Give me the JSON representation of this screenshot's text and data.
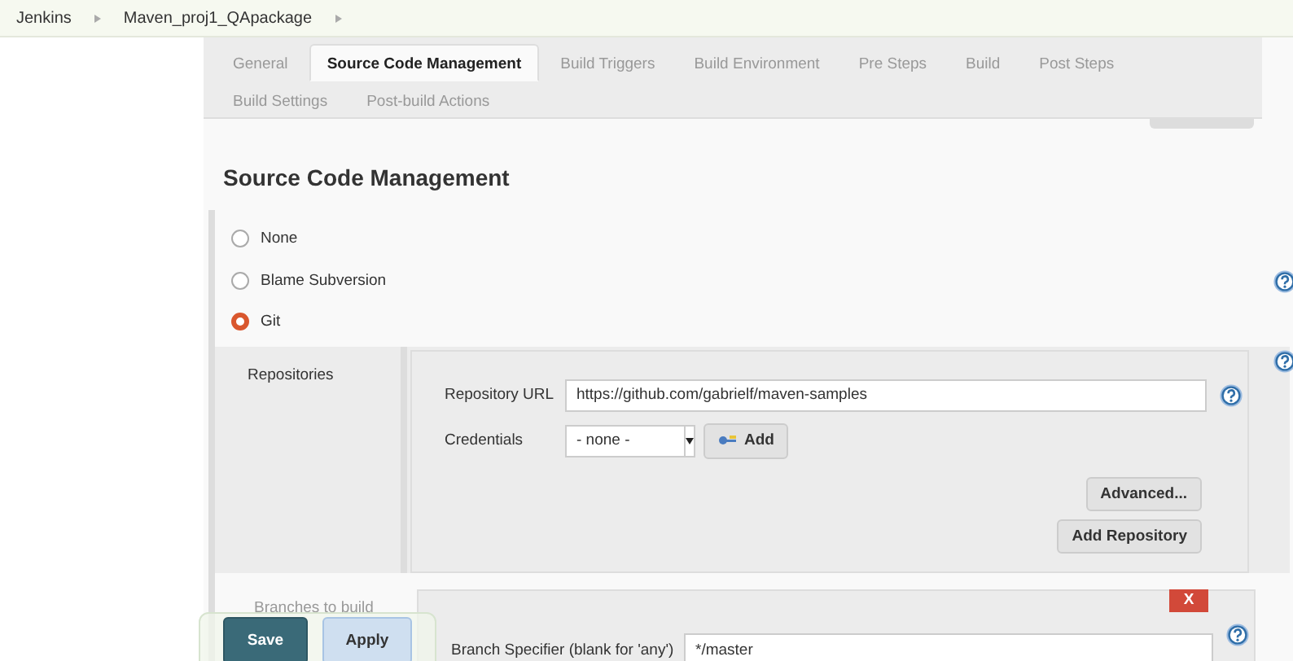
{
  "breadcrumbs": [
    {
      "label": "Jenkins"
    },
    {
      "label": "Maven_proj1_QApackage"
    }
  ],
  "tabs": [
    {
      "label": "General",
      "selected": false
    },
    {
      "label": "Source Code Management",
      "selected": true
    },
    {
      "label": "Build Triggers",
      "selected": false
    },
    {
      "label": "Build Environment",
      "selected": false
    },
    {
      "label": "Pre Steps",
      "selected": false
    },
    {
      "label": "Build",
      "selected": false
    },
    {
      "label": "Post Steps",
      "selected": false
    },
    {
      "label": "Build Settings",
      "selected": false
    },
    {
      "label": "Post-build Actions",
      "selected": false
    }
  ],
  "section_title": "Source Code Management",
  "scm_options": [
    {
      "label": "None",
      "selected": false
    },
    {
      "label": "Blame Subversion",
      "selected": false
    },
    {
      "label": "Git",
      "selected": true
    }
  ],
  "repositories": {
    "label": "Repositories",
    "url_label": "Repository URL",
    "url": "https://github.com/gabrielf/maven-samples",
    "credentials_label": "Credentials",
    "credentials": "- none -",
    "add_button": "Add",
    "advanced_button": "Advanced...",
    "add_repository_button": "Add Repository"
  },
  "branches": {
    "label": "Branches to build",
    "remove_button": "X",
    "specifier_label": "Branch Specifier (blank for 'any')",
    "specifier": "*/master"
  },
  "actions": {
    "save": "Save",
    "apply": "Apply"
  }
}
